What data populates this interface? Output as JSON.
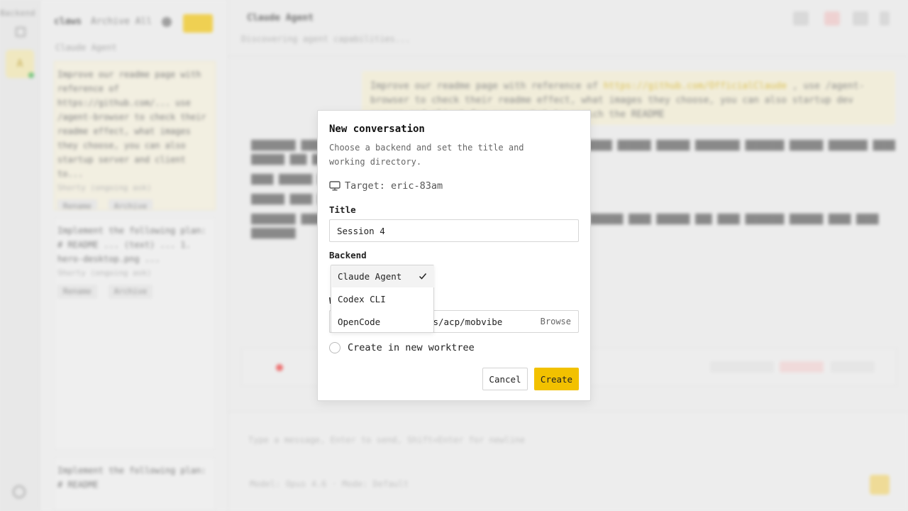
{
  "background": {
    "rail": {
      "label": "Backend",
      "avatar": "A"
    },
    "conversation_list": {
      "user": "claws",
      "archive_label": "Archive All",
      "section": "Claude Agent",
      "cards": [
        {
          "text": "Improve our readme page with reference of https://github.com/... use /agent-browser to check their readme effect, what images they choose, you can also startup server and client to...",
          "meta": "Shorty (ongoing ask)",
          "actions": [
            "Rename",
            "Archive"
          ]
        },
        {
          "text": "Implement the following plan: # README ... (text) ... 1. hero-desktop.png ...",
          "meta": "Shorty (ongoing ask)",
          "actions": [
            "Rename",
            "Archive"
          ]
        },
        {
          "text": "Implement the following plan: # README",
          "meta": "",
          "actions": []
        }
      ]
    },
    "chat": {
      "title": "Claude Agent",
      "subtitle": "Discovering agent capabilities...",
      "user_message": "Improve our readme page with reference of",
      "user_link": "https://github.com/OfficialClaude",
      "user_message_rest": ", use /agent-browser to check their readme effect, what images they choose, you can also startup dev server and client for screenshot to enrich the README",
      "composer_placeholder": "Type a message, Enter to send, Shift+Enter for newline",
      "composer_meta": "Model: Opus 4.6 · Mode: Default"
    }
  },
  "modal": {
    "title": "New conversation",
    "description": "Choose a backend and set the title and working directory.",
    "target": "Target: eric-83am",
    "title_label": "Title",
    "title_value": "Session 4",
    "backend_label": "Backend",
    "backend_options": [
      {
        "label": "Claude Agent",
        "selected": true
      },
      {
        "label": "Codex CLI",
        "selected": false
      },
      {
        "label": "OpenCode",
        "selected": false
      }
    ],
    "directory_label": "W",
    "directory_value": "/Users/eric/Sources/acp/mobvibe",
    "browse_label": "Browse",
    "worktree_label": "Create in new worktree",
    "cancel_label": "Cancel",
    "create_label": "Create"
  },
  "colors": {
    "accent": "#f2c100",
    "status_red": "#e33333",
    "online_green": "#3db34a"
  },
  "icons": {
    "target": "monitor-icon",
    "selected": "checkmark-icon"
  }
}
